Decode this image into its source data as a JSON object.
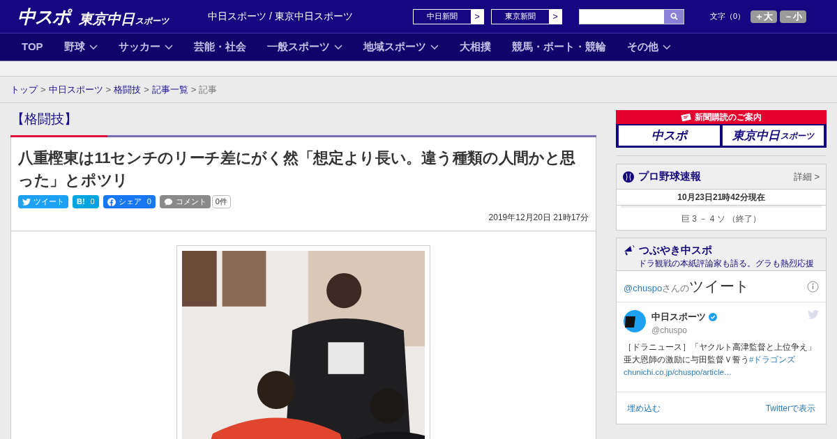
{
  "header": {
    "logo": "中スポ",
    "logo2": "東京中日",
    "logo2_small": "スポーツ",
    "site_title": "中日スポーツ / 東京中日スポーツ",
    "links": [
      {
        "label": "中日新聞",
        "arrow": ">"
      },
      {
        "label": "東京新聞",
        "arrow": ">"
      }
    ],
    "font_size": {
      "label": "文字（0）",
      "buttons": [
        "＋大",
        "－小"
      ]
    }
  },
  "nav": [
    {
      "label": "TOP",
      "dropdown": false
    },
    {
      "label": "野球",
      "dropdown": true
    },
    {
      "label": "サッカー",
      "dropdown": true
    },
    {
      "label": "芸能・社会",
      "dropdown": false
    },
    {
      "label": "一般スポーツ",
      "dropdown": true
    },
    {
      "label": "地域スポーツ",
      "dropdown": true
    },
    {
      "label": "大相撲",
      "dropdown": false
    },
    {
      "label": "競馬・ボート・競輪",
      "dropdown": false
    },
    {
      "label": "その他",
      "dropdown": true
    }
  ],
  "breadcrumb": [
    {
      "label": "トップ",
      "link": true
    },
    {
      "label": "中日スポーツ",
      "link": true
    },
    {
      "label": "格闘技",
      "link": true
    },
    {
      "label": "記事一覧",
      "link": true
    },
    {
      "label": "記事",
      "link": false
    }
  ],
  "category": "【格闘技】",
  "article": {
    "title": "八重樫東は11センチのリーチ差にがく然「想定より長い。違う種類の人間かと思った」とポツリ",
    "share": [
      {
        "kind": "twitter",
        "label": "ツイート"
      },
      {
        "kind": "hatena",
        "label": "B!",
        "count": "0"
      },
      {
        "kind": "facebook",
        "label": "シェア",
        "count": "0"
      },
      {
        "kind": "comment",
        "label": "コメント"
      }
    ],
    "comment_count": "0件",
    "date": "2019年12月20日 21時17分"
  },
  "subscribe": {
    "title": "新聞購読のご案内",
    "logos": [
      "中スポ",
      "東京中日"
    ],
    "logo_small": "スポーツ"
  },
  "baseball": {
    "title": "プロ野球速報",
    "detail": "詳細 >",
    "updated": "10月23日21時42分現在",
    "score": "巨 3 － 4 ソ （終了）"
  },
  "tweets": {
    "title": "つぶやき中スポ",
    "subtitle": "ドラ観戦の本紙評論家も語る。グラも熱烈応援",
    "handle": "@chuspo",
    "handle_suffix": "さんの",
    "heading": "ツイート",
    "name": "中日スポーツ",
    "user": "@chuspo",
    "text": "［ドラニュース］「ヤクルト高津監督と上位争え」亜大恩師の激励に与田監督Ｖ誓う",
    "hashtag": "#ドラゴンズ",
    "link": "chunichi.co.jp/chuspo/article…",
    "embed": "埋め込む",
    "view": "Twitterで表示"
  }
}
